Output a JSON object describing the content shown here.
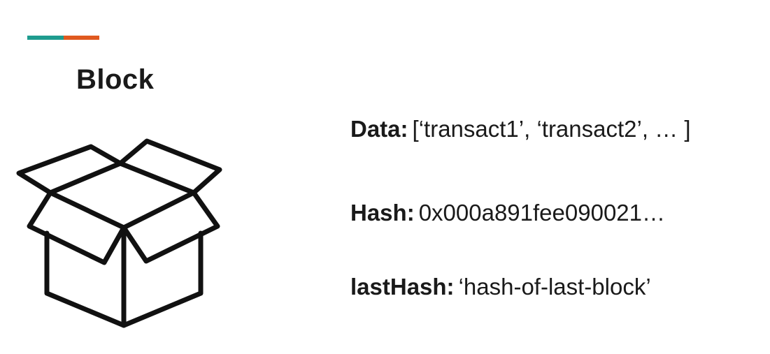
{
  "slide": {
    "title": "Block",
    "accent_colors": [
      "#1e9c8f",
      "#e0591f"
    ]
  },
  "illustration": {
    "icon": "open-box-icon",
    "stroke_color": "#111111"
  },
  "fields": [
    {
      "key": "Data:",
      "value": "[‘transact1’, ‘transact2’, … ]"
    },
    {
      "key": "Hash:",
      "value": "0x000a891fee090021…"
    },
    {
      "key": "lastHash:",
      "value": "‘hash-of-last-block’"
    }
  ]
}
